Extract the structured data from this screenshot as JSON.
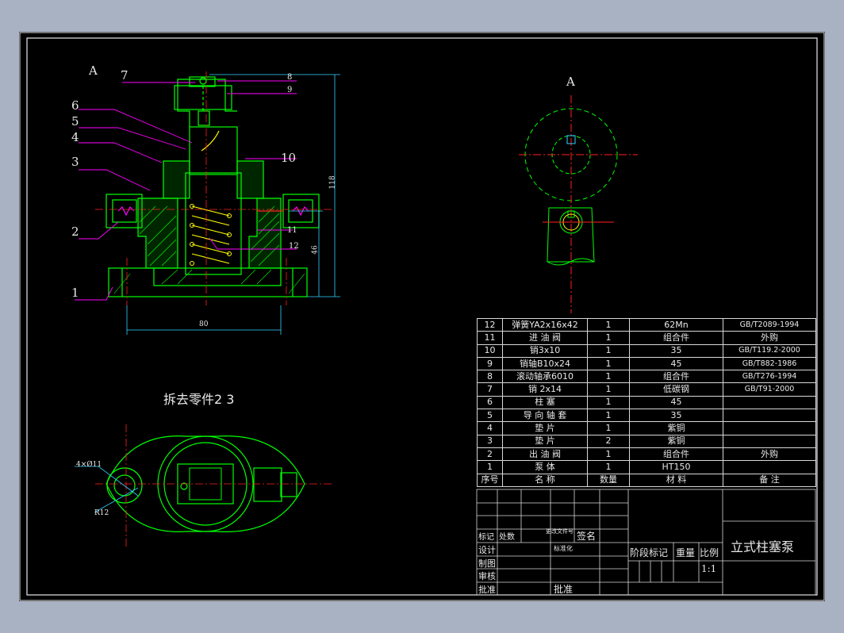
{
  "view_label": "A",
  "balloons": [
    "1",
    "2",
    "3",
    "4",
    "5",
    "6",
    "7",
    "8",
    "9",
    "10",
    "11",
    "12"
  ],
  "dims": {
    "height_total": "118",
    "height_46": "46",
    "width_80": "80",
    "holes": "4×Ø11",
    "radius": "R12"
  },
  "removed_note": "拆去零件2 3",
  "bom": {
    "header": {
      "no": "序号",
      "name": "名 称",
      "qty": "数量",
      "material": "材 料",
      "remark": "备 注"
    },
    "rows": [
      {
        "no": "12",
        "name": "弹簧YA2x16x42",
        "qty": "1",
        "material": "62Mn",
        "remark": "GB/T2089-1994"
      },
      {
        "no": "11",
        "name": "进 油 阀",
        "qty": "1",
        "material": "组合件",
        "remark": "外购"
      },
      {
        "no": "10",
        "name": "销3x10",
        "qty": "1",
        "material": "35",
        "remark": "GB/T119.2-2000"
      },
      {
        "no": "9",
        "name": "销轴B10x24",
        "qty": "1",
        "material": "45",
        "remark": "GB/T882-1986"
      },
      {
        "no": "8",
        "name": "滚动轴承6010",
        "qty": "1",
        "material": "组合件",
        "remark": "GB/T276-1994"
      },
      {
        "no": "7",
        "name": "销 2x14",
        "qty": "1",
        "material": "低碳钢",
        "remark": "GB/T91-2000"
      },
      {
        "no": "6",
        "name": "柱 塞",
        "qty": "1",
        "material": "45",
        "remark": ""
      },
      {
        "no": "5",
        "name": "导 向 轴 套",
        "qty": "1",
        "material": "35",
        "remark": ""
      },
      {
        "no": "4",
        "name": "垫 片",
        "qty": "1",
        "material": "紫铜",
        "remark": ""
      },
      {
        "no": "3",
        "name": "垫 片",
        "qty": "2",
        "material": "紫铜",
        "remark": ""
      },
      {
        "no": "2",
        "name": "出 油 阀",
        "qty": "1",
        "material": "组合件",
        "remark": "外购"
      },
      {
        "no": "1",
        "name": "泵 体",
        "qty": "1",
        "material": "HT150",
        "remark": ""
      }
    ]
  },
  "title_block": {
    "mark": "标记",
    "count": "处数",
    "zone_file": "更改文件号",
    "sign": "签名",
    "design": "设计",
    "draw": "制图",
    "check": "审核",
    "approve": "批准",
    "std": "标准化",
    "approve2": "批准",
    "stage": "阶段标记",
    "weight": "重量",
    "scale": "比例",
    "scale_val": "1:1",
    "drawing_name": "立式柱塞泵"
  },
  "colors": {
    "outline": "#00ff00",
    "center": "#ff2020",
    "leader": "#ff00ff",
    "dim": "#34d3ff",
    "hidden": "#ffff00"
  }
}
